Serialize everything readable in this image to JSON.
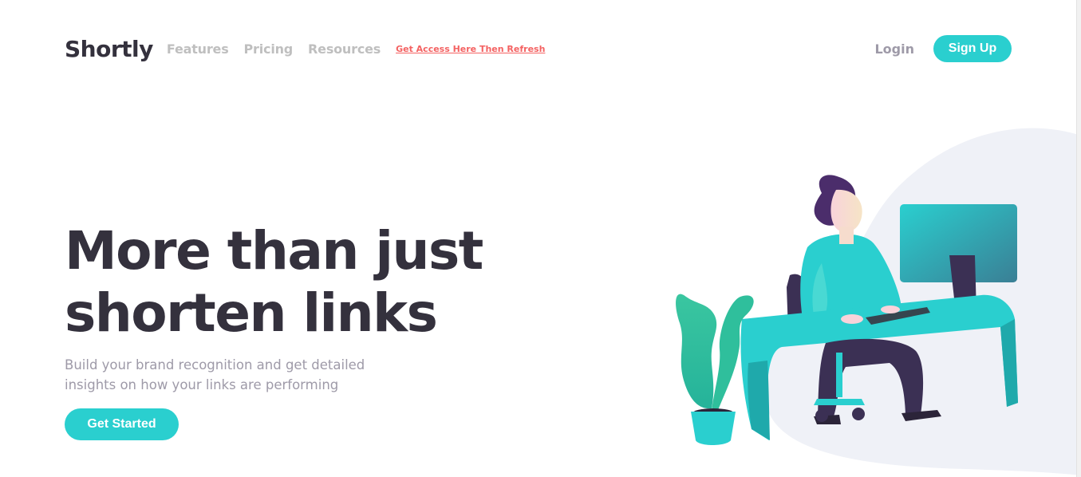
{
  "header": {
    "logo": "Shortly",
    "nav": {
      "features": "Features",
      "pricing": "Pricing",
      "resources": "Resources",
      "access_link": "Get Access Here Then Refresh"
    },
    "login": "Login",
    "signup": "Sign Up"
  },
  "hero": {
    "title_line1": "More than just",
    "title_line2": "shorten links",
    "subtitle": "Build your brand recognition and get detailed insights on how your links are performing",
    "cta": "Get Started"
  },
  "colors": {
    "cyan": "#2acfcf",
    "dark_violet": "#34313d",
    "grayish_violet": "#9e9aa8",
    "gray": "#bfbfbf",
    "red": "#f46262"
  },
  "illustration": {
    "icon": "person-working-illustration"
  }
}
